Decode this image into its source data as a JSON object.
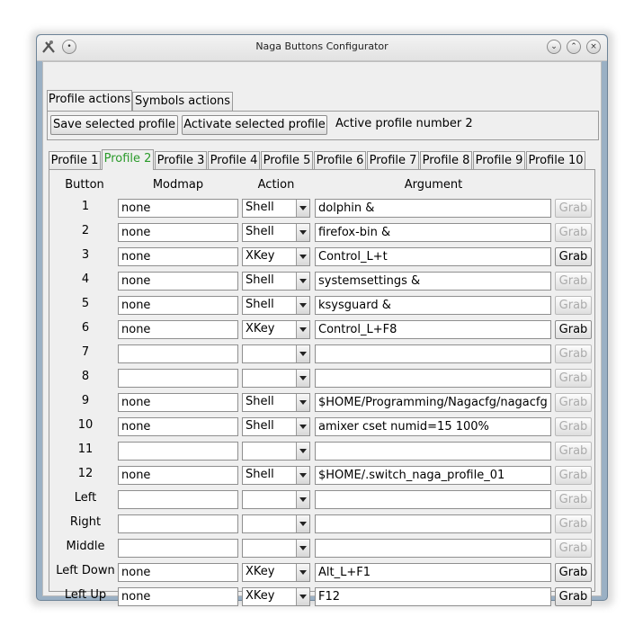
{
  "window": {
    "title": "Naga Buttons Configurator"
  },
  "icons": {
    "app": "naga-app-icon",
    "menu": "window-menu-icon",
    "minimize": "minimize-icon",
    "maximize": "maximize-icon",
    "close": "close-icon"
  },
  "top_tabs": [
    {
      "label": "Profile actions",
      "active": true
    },
    {
      "label": "Symbols actions",
      "active": false
    }
  ],
  "profile_actions": {
    "save_label": "Save selected profile",
    "activate_label": "Activate selected profile",
    "status": "Active profile number 2"
  },
  "profile_tabs": [
    {
      "label": "Profile 1",
      "active": false
    },
    {
      "label": "Profile 2",
      "active": true
    },
    {
      "label": "Profile 3",
      "active": false
    },
    {
      "label": "Profile 4",
      "active": false
    },
    {
      "label": "Profile 5",
      "active": false
    },
    {
      "label": "Profile 6",
      "active": false
    },
    {
      "label": "Profile 7",
      "active": false
    },
    {
      "label": "Profile 8",
      "active": false
    },
    {
      "label": "Profile 9",
      "active": false
    },
    {
      "label": "Profile 10",
      "active": false
    }
  ],
  "table": {
    "headers": {
      "button": "Button",
      "modmap": "Modmap",
      "action": "Action",
      "argument": "Argument"
    },
    "grab_label": "Grab",
    "rows": [
      {
        "button": "1",
        "modmap": "none",
        "action": "Shell",
        "argument": "dolphin &",
        "grab_enabled": false
      },
      {
        "button": "2",
        "modmap": "none",
        "action": "Shell",
        "argument": "firefox-bin &",
        "grab_enabled": false
      },
      {
        "button": "3",
        "modmap": "none",
        "action": "XKey",
        "argument": "Control_L+t",
        "grab_enabled": true
      },
      {
        "button": "4",
        "modmap": "none",
        "action": "Shell",
        "argument": "systemsettings &",
        "grab_enabled": false
      },
      {
        "button": "5",
        "modmap": "none",
        "action": "Shell",
        "argument": "ksysguard &",
        "grab_enabled": false
      },
      {
        "button": "6",
        "modmap": "none",
        "action": "XKey",
        "argument": "Control_L+F8",
        "grab_enabled": true
      },
      {
        "button": "7",
        "modmap": "",
        "action": "",
        "argument": "",
        "grab_enabled": false
      },
      {
        "button": "8",
        "modmap": "",
        "action": "",
        "argument": "",
        "grab_enabled": false
      },
      {
        "button": "9",
        "modmap": "none",
        "action": "Shell",
        "argument": "$HOME/Programming/Nagacfg/nagacfg &",
        "grab_enabled": false
      },
      {
        "button": "10",
        "modmap": "none",
        "action": "Shell",
        "argument": "amixer cset numid=15 100%",
        "grab_enabled": false
      },
      {
        "button": "11",
        "modmap": "",
        "action": "",
        "argument": "",
        "grab_enabled": false
      },
      {
        "button": "12",
        "modmap": "none",
        "action": "Shell",
        "argument": "$HOME/.switch_naga_profile_01",
        "grab_enabled": false
      },
      {
        "button": "Left",
        "modmap": "",
        "action": "",
        "argument": "",
        "grab_enabled": false
      },
      {
        "button": "Right",
        "modmap": "",
        "action": "",
        "argument": "",
        "grab_enabled": false
      },
      {
        "button": "Middle",
        "modmap": "",
        "action": "",
        "argument": "",
        "grab_enabled": false
      },
      {
        "button": "Left Down",
        "modmap": "none",
        "action": "XKey",
        "argument": "Alt_L+F1",
        "grab_enabled": true
      },
      {
        "button": "Left Up",
        "modmap": "none",
        "action": "XKey",
        "argument": "F12",
        "grab_enabled": true
      }
    ]
  },
  "colors": {
    "frame": "#9ab0c4",
    "active_tab_text": "#2a9a2a",
    "disabled_text": "#a8a8a8"
  }
}
